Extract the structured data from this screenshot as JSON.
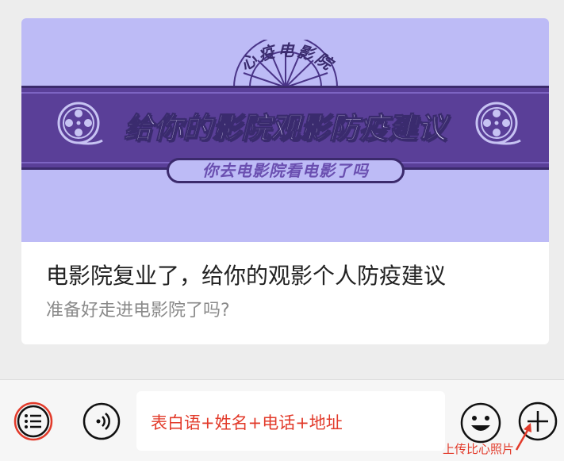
{
  "article_card": {
    "banner": {
      "arc_text": "心疫电影院",
      "headline": "给你的影院观影防疫建议",
      "pill_text": "你去电影院看电影了吗"
    },
    "title": "电影院复业了，给你的观影个人防疫建议",
    "subtitle": "准备好走进电影院了吗?"
  },
  "chat_input_bar": {
    "menu_icon": "list-menu-icon",
    "voice_icon": "voice-icon",
    "input_value": "表白语+姓名+电话+地址",
    "emoji_icon": "smiley-icon",
    "plus_icon": "plus-icon",
    "annotation": "上传比心照片"
  },
  "colors": {
    "banner_bg": "#bdbbf6",
    "ribbon": "#5a3f98",
    "annotation_red": "#e23a2a"
  }
}
